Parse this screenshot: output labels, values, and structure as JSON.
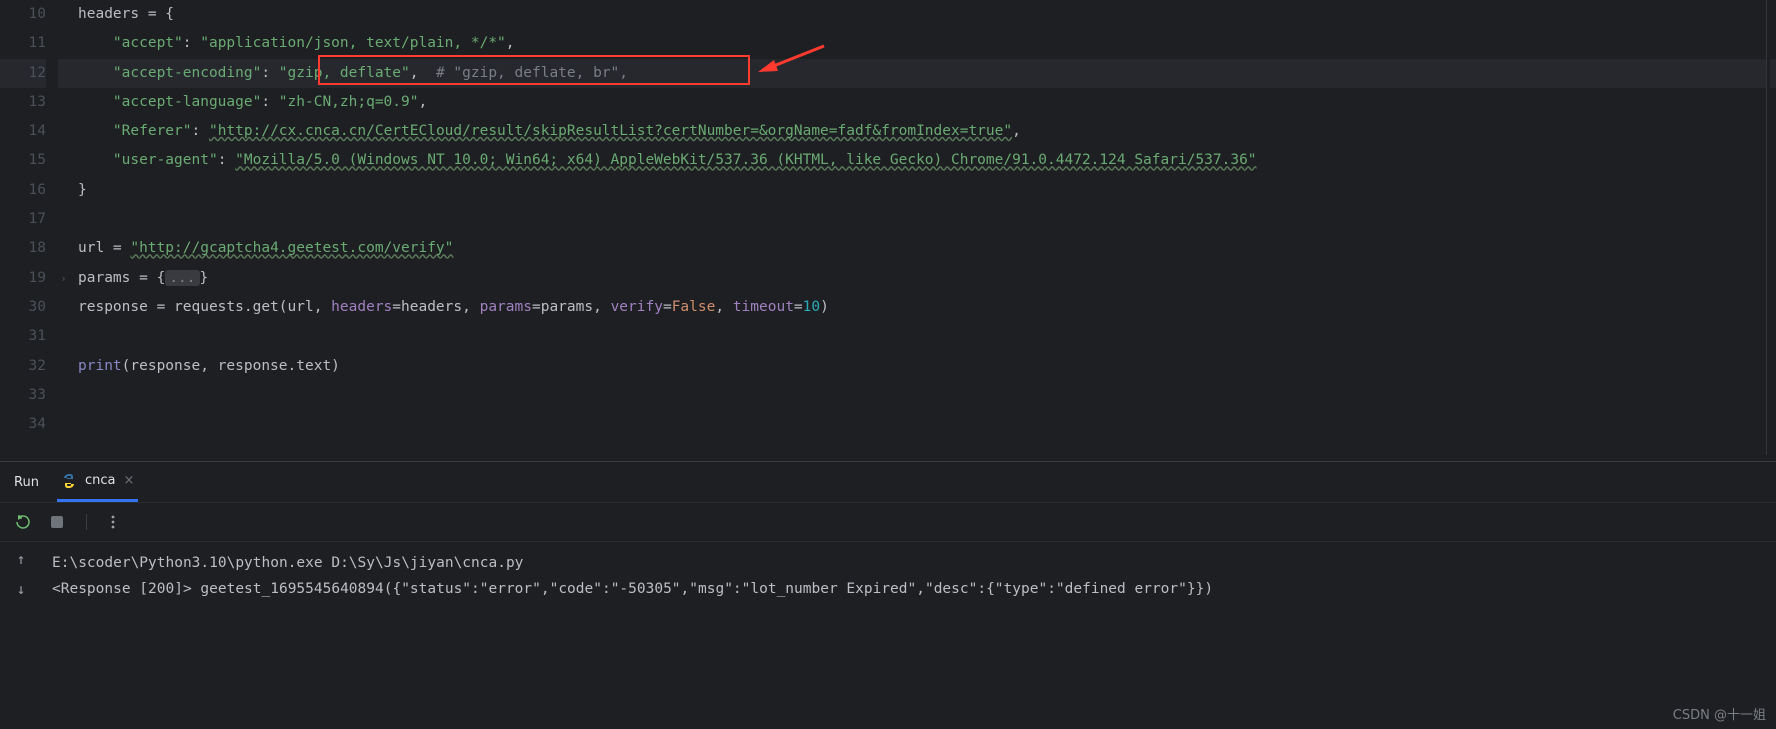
{
  "gutter": [
    "10",
    "11",
    "12",
    "13",
    "14",
    "15",
    "16",
    "17",
    "18",
    "19",
    "30",
    "31",
    "32",
    "33",
    "34"
  ],
  "code": {
    "l10": {
      "pre": "headers = {"
    },
    "l11": {
      "k": "\"accept\"",
      "v": "\"application/json, text/plain, */*\"",
      "tail": ","
    },
    "l12": {
      "k": "\"accept-encoding\"",
      "v": "\"gzip, deflate\"",
      "tail": ",  ",
      "c": "# \"gzip, deflate, br\","
    },
    "l13": {
      "k": "\"accept-language\"",
      "v": "\"zh-CN,zh;q=0.9\"",
      "tail": ","
    },
    "l14": {
      "k": "\"Referer\"",
      "v": "\"http://cx.cnca.cn/CertECloud/result/skipResultList?certNumber=&orgName=fadf&fromIndex=true\"",
      "tail": ","
    },
    "l15": {
      "k": "\"user-agent\"",
      "v": "\"Mozilla/5.0 (Windows NT 10.0; Win64; x64) AppleWebKit/537.36 (KHTML, like Gecko) Chrome/91.0.4472.124 Safari/537.36\""
    },
    "l16": {
      "pre": "}"
    },
    "l18": {
      "a": "url = ",
      "v": "\"http://gcaptcha4.geetest.com/verify\""
    },
    "l19": {
      "a": "params = {",
      "fold": "...",
      "b": "}"
    },
    "l30": {
      "a": "response = requests.get(url, ",
      "p1": "headers",
      "p1v": "=headers, ",
      "p2": "params",
      "p2v": "=params, ",
      "p3": "verify",
      "p3v": "=",
      "p3b": "False",
      "p3t": ", ",
      "p4": "timeout",
      "p4v": "=",
      "p4n": "10",
      "p4t": ")"
    },
    "l32": {
      "fn": "print",
      "rest": "(response, response.text)"
    }
  },
  "run": {
    "label": "Run",
    "tab_name": "cnca",
    "close": "×"
  },
  "console": {
    "line1": "E:\\scoder\\Python3.10\\python.exe D:\\Sy\\Js\\jiyan\\cnca.py",
    "line2": "<Response [200]> geetest_1695545640894({\"status\":\"error\",\"code\":\"-50305\",\"msg\":\"lot_number Expired\",\"desc\":{\"type\":\"defined error\"}})"
  },
  "watermark": "CSDN @十一姐"
}
